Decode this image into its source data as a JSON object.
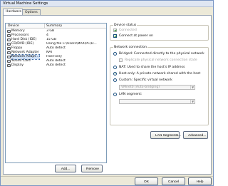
{
  "window": {
    "title": "Virtual Machine Settings"
  },
  "tabs": [
    {
      "label": "Hardware",
      "active": true
    },
    {
      "label": "Options",
      "active": false
    }
  ],
  "device_list": {
    "columns": [
      "Device",
      "Summary"
    ],
    "rows": [
      {
        "device": "Memory",
        "summary": "3 GB",
        "icon": "memory-icon"
      },
      {
        "device": "Processors",
        "summary": "4",
        "icon": "processor-icon"
      },
      {
        "device": "Hard Disk (IDE)",
        "summary": "15 GB",
        "icon": "hard-disk-icon"
      },
      {
        "device": "CD/DVD (IDE)",
        "summary": "Using file C:\\Users\\MAX\\PC\\D...",
        "icon": "cd-dvd-icon"
      },
      {
        "device": "Floppy",
        "summary": "Auto detect",
        "icon": "floppy-icon"
      },
      {
        "device": "Network Adapter",
        "summary": "NAT",
        "icon": "network-adapter-icon"
      },
      {
        "device": "Network Adapt...",
        "summary": "Host-only",
        "icon": "network-adapter-icon",
        "selected": true
      },
      {
        "device": "Sound Card",
        "summary": "Auto detect",
        "icon": "sound-card-icon"
      },
      {
        "device": "Display",
        "summary": "Auto detect",
        "icon": "display-icon"
      }
    ]
  },
  "device_status": {
    "title": "Device status",
    "connected": {
      "label": "Connected",
      "checked": true,
      "enabled": false
    },
    "connect_at_power_on": {
      "label": "Connect at power on",
      "checked": true,
      "enabled": true
    }
  },
  "network_connection": {
    "title": "Network connection",
    "options": {
      "bridged": {
        "label": "Bridged: Connected directly to the physical network",
        "selected": false
      },
      "replicate": {
        "label": "Replicate physical network connection state",
        "checked": false,
        "enabled": false
      },
      "nat": {
        "label": "NAT: Used to share the host's IP address",
        "selected": false
      },
      "host_only": {
        "label": "Host-only: A private network shared with the host",
        "selected": true
      },
      "custom": {
        "label": "Custom: Specific virtual network",
        "selected": false
      },
      "custom_value": "VMnet0 (Auto-bridging)",
      "lan_segment": {
        "label": "LAN segment:",
        "selected": false
      },
      "lan_segment_value": ""
    }
  },
  "buttons": {
    "lan_segments": "LAN Segments...",
    "advanced": "Advanced...",
    "add": "Add...",
    "remove": "Remove",
    "ok": "OK",
    "cancel": "Cancel",
    "help": "Help"
  },
  "colors": {
    "selection": "#cfe0f7",
    "radio_dot": "#1d8a1d",
    "border": "#7f9db9"
  }
}
